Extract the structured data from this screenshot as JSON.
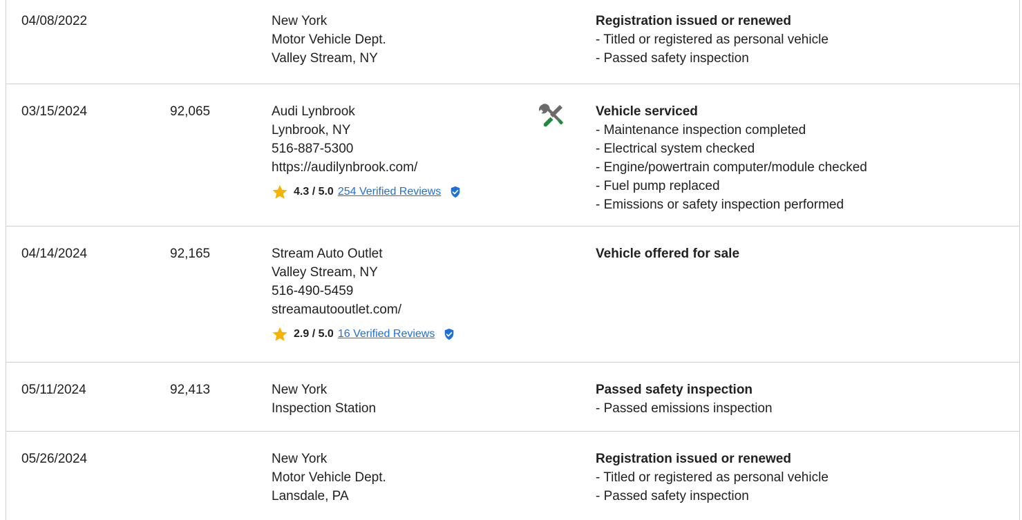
{
  "records": [
    {
      "date": "04/08/2022",
      "odometer": "",
      "source_lines": [
        "New York",
        "Motor Vehicle Dept.",
        "Valley Stream, NY"
      ],
      "has_service_icon": false,
      "rating": null,
      "detail_title": "Registration issued or renewed",
      "detail_items": [
        "- Titled or registered as personal vehicle",
        "- Passed safety inspection"
      ]
    },
    {
      "date": "03/15/2024",
      "odometer": "92,065",
      "source_lines": [
        "Audi Lynbrook",
        "Lynbrook, NY",
        "516-887-5300",
        "https://audilynbrook.com/"
      ],
      "has_service_icon": true,
      "rating": {
        "score": "4.3 / 5.0",
        "reviews": "254 Verified Reviews"
      },
      "detail_title": "Vehicle serviced",
      "detail_items": [
        "- Maintenance inspection completed",
        "- Electrical system checked",
        "- Engine/powertrain computer/module checked",
        "- Fuel pump replaced",
        "- Emissions or safety inspection performed"
      ]
    },
    {
      "date": "04/14/2024",
      "odometer": "92,165",
      "source_lines": [
        "Stream Auto Outlet",
        "Valley Stream, NY",
        "516-490-5459",
        "streamautooutlet.com/"
      ],
      "has_service_icon": false,
      "rating": {
        "score": "2.9 / 5.0",
        "reviews": "16 Verified Reviews"
      },
      "detail_title": "Vehicle offered for sale",
      "detail_items": []
    },
    {
      "date": "05/11/2024",
      "odometer": "92,413",
      "source_lines": [
        "New York",
        "Inspection Station"
      ],
      "has_service_icon": false,
      "rating": null,
      "detail_title": "Passed safety inspection",
      "detail_items": [
        "- Passed emissions inspection"
      ]
    },
    {
      "date": "05/26/2024",
      "odometer": "",
      "source_lines": [
        "New York",
        "Motor Vehicle Dept.",
        "Lansdale, PA"
      ],
      "has_service_icon": false,
      "rating": null,
      "detail_title": "Registration issued or renewed",
      "detail_items": [
        "- Titled or registered as personal vehicle",
        "- Passed safety inspection"
      ]
    }
  ],
  "icons": {
    "star": "star-icon",
    "verified": "verified-shield-icon",
    "service": "wrench-screwdriver-icon"
  },
  "colors": {
    "star": "#f5b400",
    "verified": "#1e6fd9",
    "link": "#1e6fd9",
    "service_tool_gray": "#6b6b6b",
    "service_tool_green": "#1f8a3a",
    "divider": "#cfcfcf"
  }
}
